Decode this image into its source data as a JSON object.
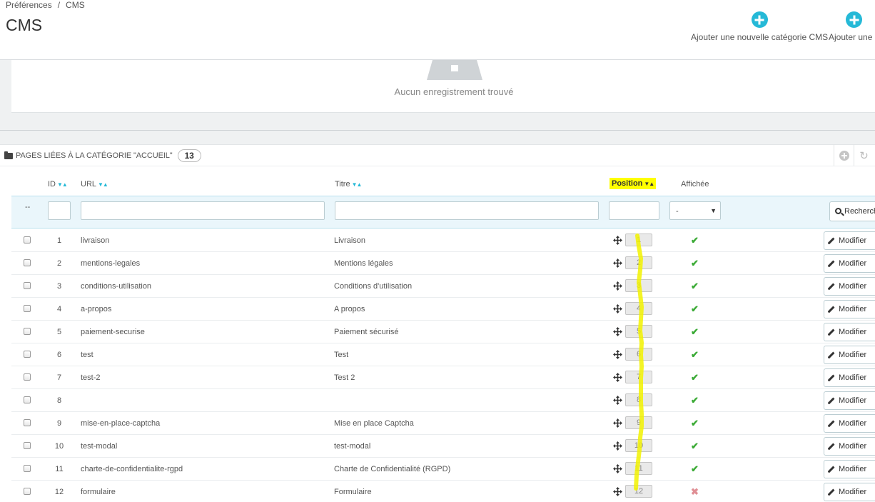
{
  "breadcrumb": {
    "parent": "Préférences",
    "separator": "/",
    "current": "CMS"
  },
  "page_title": "CMS",
  "toolbar": {
    "add_category": "Ajouter une nouvelle catégorie CMS",
    "add_page": "Ajouter une p"
  },
  "empty_message": "Aucun enregistrement trouvé",
  "panel": {
    "heading": "Pages liées à la catégorie \"Accueil\"",
    "count": "13"
  },
  "table": {
    "headers": {
      "id": "ID",
      "url": "URL",
      "title": "Titre",
      "position": "Position",
      "displayed": "Affichée"
    },
    "filter": {
      "dash": "--",
      "displayed_select": "-",
      "search_button": "Recherche"
    },
    "edit_label": "Modifier",
    "rows": [
      {
        "id": "1",
        "url": "livraison",
        "title": "Livraison",
        "position": "1",
        "displayed": true
      },
      {
        "id": "2",
        "url": "mentions-legales",
        "title": "Mentions légales",
        "position": "2",
        "displayed": true
      },
      {
        "id": "3",
        "url": "conditions-utilisation",
        "title": "Conditions d'utilisation",
        "position": "3",
        "displayed": true
      },
      {
        "id": "4",
        "url": "a-propos",
        "title": "A propos",
        "position": "4",
        "displayed": true
      },
      {
        "id": "5",
        "url": "paiement-securise",
        "title": "Paiement sécurisé",
        "position": "5",
        "displayed": true
      },
      {
        "id": "6",
        "url": "test",
        "title": "Test",
        "position": "6",
        "displayed": true
      },
      {
        "id": "7",
        "url": "test-2",
        "title": "Test 2",
        "position": "7",
        "displayed": true
      },
      {
        "id": "8",
        "url": "",
        "title": "",
        "position": "8",
        "displayed": true
      },
      {
        "id": "9",
        "url": "mise-en-place-captcha",
        "title": "Mise en place Captcha",
        "position": "9",
        "displayed": true
      },
      {
        "id": "10",
        "url": "test-modal",
        "title": "test-modal",
        "position": "10",
        "displayed": true
      },
      {
        "id": "11",
        "url": "charte-de-confidentialite-rgpd",
        "title": "Charte de Confidentialité (RGPD)",
        "position": "11",
        "displayed": true
      },
      {
        "id": "12",
        "url": "formulaire",
        "title": "Formulaire",
        "position": "12",
        "displayed": false
      }
    ]
  },
  "colors": {
    "accent": "#25b9d7",
    "success": "#3aaa35",
    "danger": "#e08f95",
    "highlight": "#ffff00"
  },
  "icons": {
    "add": "plus-circle-icon",
    "drag": "move-arrows-icon",
    "edit": "pencil-icon",
    "search": "search-icon",
    "refresh": "refresh-icon",
    "folder": "folder-icon",
    "yes": "check-icon",
    "no": "cross-icon"
  }
}
